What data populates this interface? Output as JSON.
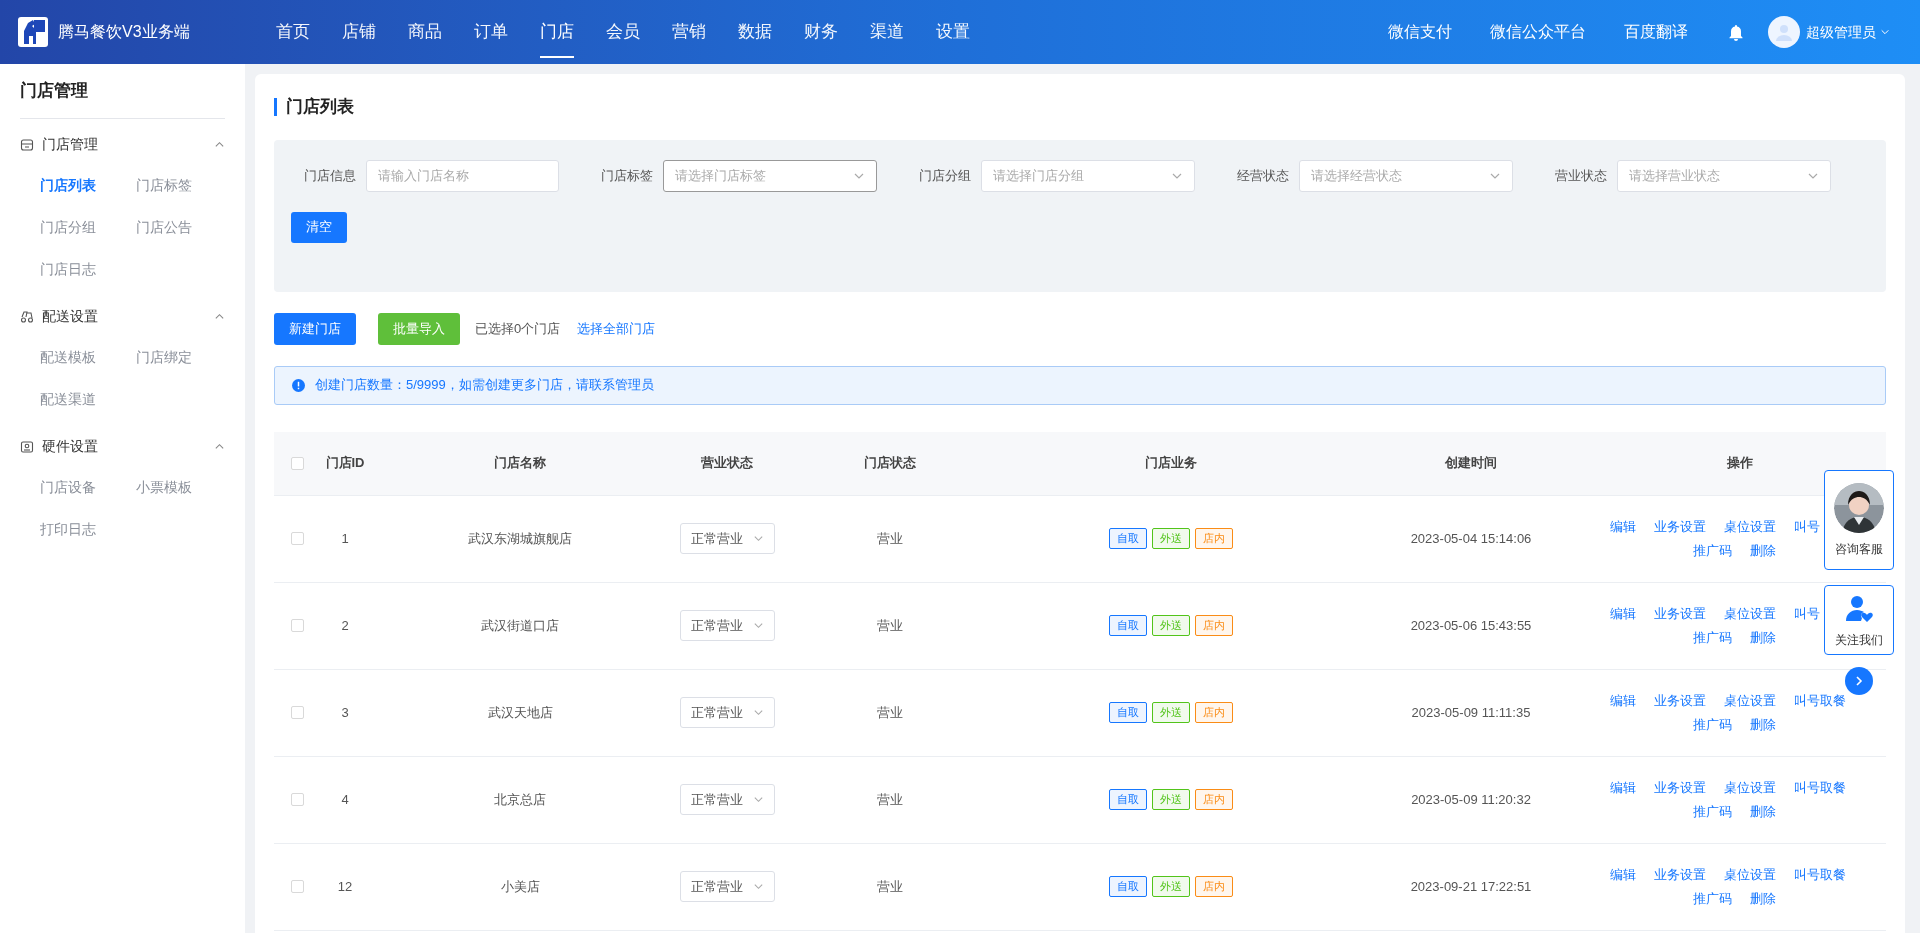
{
  "app": {
    "title": "腾马餐饮V3业务端"
  },
  "nav": [
    {
      "label": "首页",
      "selected": false
    },
    {
      "label": "店铺",
      "selected": false
    },
    {
      "label": "商品",
      "selected": false
    },
    {
      "label": "订单",
      "selected": false
    },
    {
      "label": "门店",
      "selected": true
    },
    {
      "label": "会员",
      "selected": false
    },
    {
      "label": "营销",
      "selected": false
    },
    {
      "label": "数据",
      "selected": false
    },
    {
      "label": "财务",
      "selected": false
    },
    {
      "label": "渠道",
      "selected": false
    },
    {
      "label": "设置",
      "selected": false
    }
  ],
  "top_links": [
    "微信支付",
    "微信公众平台",
    "百度翻译"
  ],
  "user": {
    "name": "超级管理员"
  },
  "sidebar": {
    "title": "门店管理",
    "groups": [
      {
        "title": "门店管理",
        "kind": "store",
        "expanded": true,
        "items": [
          {
            "label": "门店列表",
            "selected": true
          },
          {
            "label": "门店标签",
            "selected": false
          },
          {
            "label": "门店分组",
            "selected": false
          },
          {
            "label": "门店公告",
            "selected": false
          },
          {
            "label": "门店日志",
            "selected": false
          }
        ]
      },
      {
        "title": "配送设置",
        "kind": "delivery",
        "expanded": true,
        "items": [
          {
            "label": "配送模板",
            "selected": false
          },
          {
            "label": "门店绑定",
            "selected": false
          },
          {
            "label": "配送渠道",
            "selected": false
          }
        ]
      },
      {
        "title": "硬件设置",
        "kind": "device",
        "expanded": true,
        "items": [
          {
            "label": "门店设备",
            "selected": false
          },
          {
            "label": "小票模板",
            "selected": false
          },
          {
            "label": "打印日志",
            "selected": false
          }
        ]
      }
    ]
  },
  "page": {
    "title": "门店列表"
  },
  "filters": [
    {
      "label": "门店信息",
      "kind": "input",
      "placeholder": "请输入门店名称",
      "focused": false
    },
    {
      "label": "门店标签",
      "kind": "select",
      "placeholder": "请选择门店标签",
      "focused": true
    },
    {
      "label": "门店分组",
      "kind": "select",
      "placeholder": "请选择门店分组",
      "focused": false
    },
    {
      "label": "经营状态",
      "kind": "select",
      "placeholder": "请选择经营状态",
      "focused": false
    },
    {
      "label": "营业状态",
      "kind": "select",
      "placeholder": "请选择营业状态",
      "focused": false
    }
  ],
  "clear_button": "清空",
  "toolbar": {
    "new_button": "新建门店",
    "import_button": "批量导入",
    "selection": "已选择0个门店",
    "select_all": "选择全部门店"
  },
  "alert": "创建门店数量：5/9999，如需创建更多门店，请联系管理员",
  "table": {
    "header_checked": false,
    "columns": [
      "门店ID",
      "门店名称",
      "营业状态",
      "门店状态",
      "门店业务",
      "创建时间",
      "操作"
    ],
    "rows": [
      {
        "checked": false,
        "id": "1",
        "name": "武汉东湖城旗舰店",
        "business_status": "正常营业",
        "store_status": "营业",
        "tags": [
          {
            "label": "自取",
            "color": "#1677ff"
          },
          {
            "label": "外送",
            "color": "#52c41a"
          },
          {
            "label": "店内",
            "color": "#fa8c16"
          }
        ],
        "created": "2023-05-04 15:14:06",
        "actions": [
          "编辑",
          "业务设置",
          "桌位设置",
          "叫号",
          "推广码",
          "删除"
        ]
      },
      {
        "checked": false,
        "id": "2",
        "name": "武汉街道口店",
        "business_status": "正常营业",
        "store_status": "营业",
        "tags": [
          {
            "label": "自取",
            "color": "#1677ff"
          },
          {
            "label": "外送",
            "color": "#52c41a"
          },
          {
            "label": "店内",
            "color": "#fa8c16"
          }
        ],
        "created": "2023-05-06 15:43:55",
        "actions": [
          "编辑",
          "业务设置",
          "桌位设置",
          "叫号",
          "推广码",
          "删除"
        ]
      },
      {
        "checked": false,
        "id": "3",
        "name": "武汉天地店",
        "business_status": "正常营业",
        "store_status": "营业",
        "tags": [
          {
            "label": "自取",
            "color": "#1677ff"
          },
          {
            "label": "外送",
            "color": "#52c41a"
          },
          {
            "label": "店内",
            "color": "#fa8c16"
          }
        ],
        "created": "2023-05-09 11:11:35",
        "actions": [
          "编辑",
          "业务设置",
          "桌位设置",
          "叫号取餐",
          "推广码",
          "删除"
        ]
      },
      {
        "checked": false,
        "id": "4",
        "name": "北京总店",
        "business_status": "正常营业",
        "store_status": "营业",
        "tags": [
          {
            "label": "自取",
            "color": "#1677ff"
          },
          {
            "label": "外送",
            "color": "#52c41a"
          },
          {
            "label": "店内",
            "color": "#fa8c16"
          }
        ],
        "created": "2023-05-09 11:20:32",
        "actions": [
          "编辑",
          "业务设置",
          "桌位设置",
          "叫号取餐",
          "推广码",
          "删除"
        ]
      },
      {
        "checked": false,
        "id": "12",
        "name": "小美店",
        "business_status": "正常营业",
        "store_status": "营业",
        "tags": [
          {
            "label": "自取",
            "color": "#1677ff"
          },
          {
            "label": "外送",
            "color": "#52c41a"
          },
          {
            "label": "店内",
            "color": "#fa8c16"
          }
        ],
        "created": "2023-09-21 17:22:51",
        "actions": [
          "编辑",
          "业务设置",
          "桌位设置",
          "叫号取餐",
          "推广码",
          "删除"
        ]
      }
    ]
  },
  "float_widgets": [
    {
      "label": "咨询客服"
    },
    {
      "label": "关注我们",
      "kind": "follow"
    }
  ]
}
